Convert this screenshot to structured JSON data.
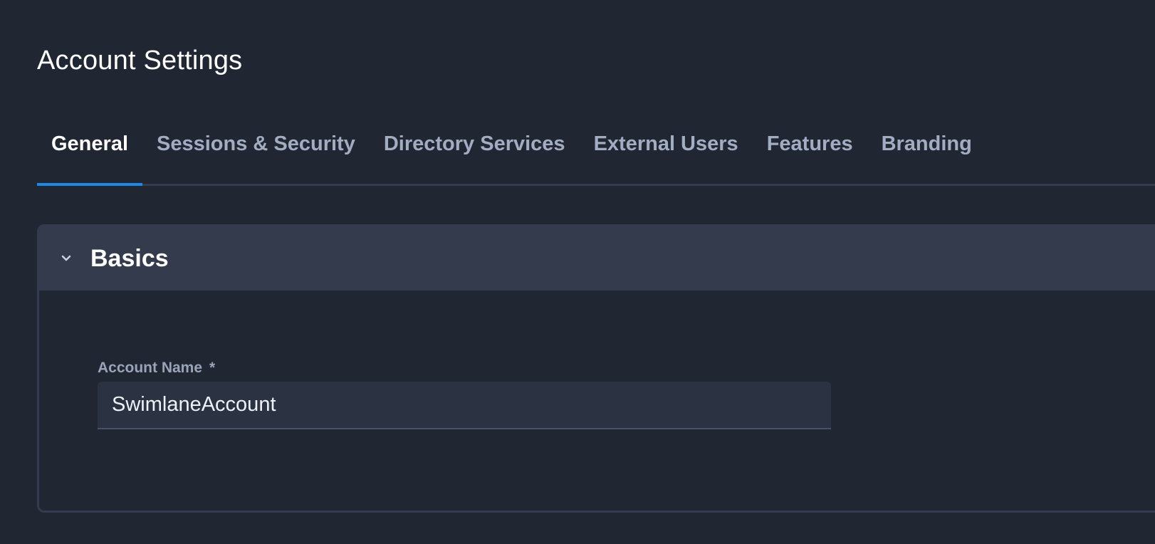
{
  "page": {
    "title": "Account Settings"
  },
  "tabs": [
    {
      "label": "General",
      "active": true
    },
    {
      "label": "Sessions & Security",
      "active": false
    },
    {
      "label": "Directory Services",
      "active": false
    },
    {
      "label": "External Users",
      "active": false
    },
    {
      "label": "Features",
      "active": false
    },
    {
      "label": "Branding",
      "active": false
    }
  ],
  "section": {
    "title": "Basics",
    "toggle_icon": "chevron-down-icon",
    "expanded": true
  },
  "form": {
    "account_name": {
      "label": "Account Name",
      "required_marker": "*",
      "value": "SwimlaneAccount"
    }
  },
  "colors": {
    "background": "#212633",
    "panel_header": "#343b4c",
    "active_tab_indicator": "#1e88e5",
    "input_background": "#2b3241",
    "inactive_tab_text": "#a3adc1"
  }
}
